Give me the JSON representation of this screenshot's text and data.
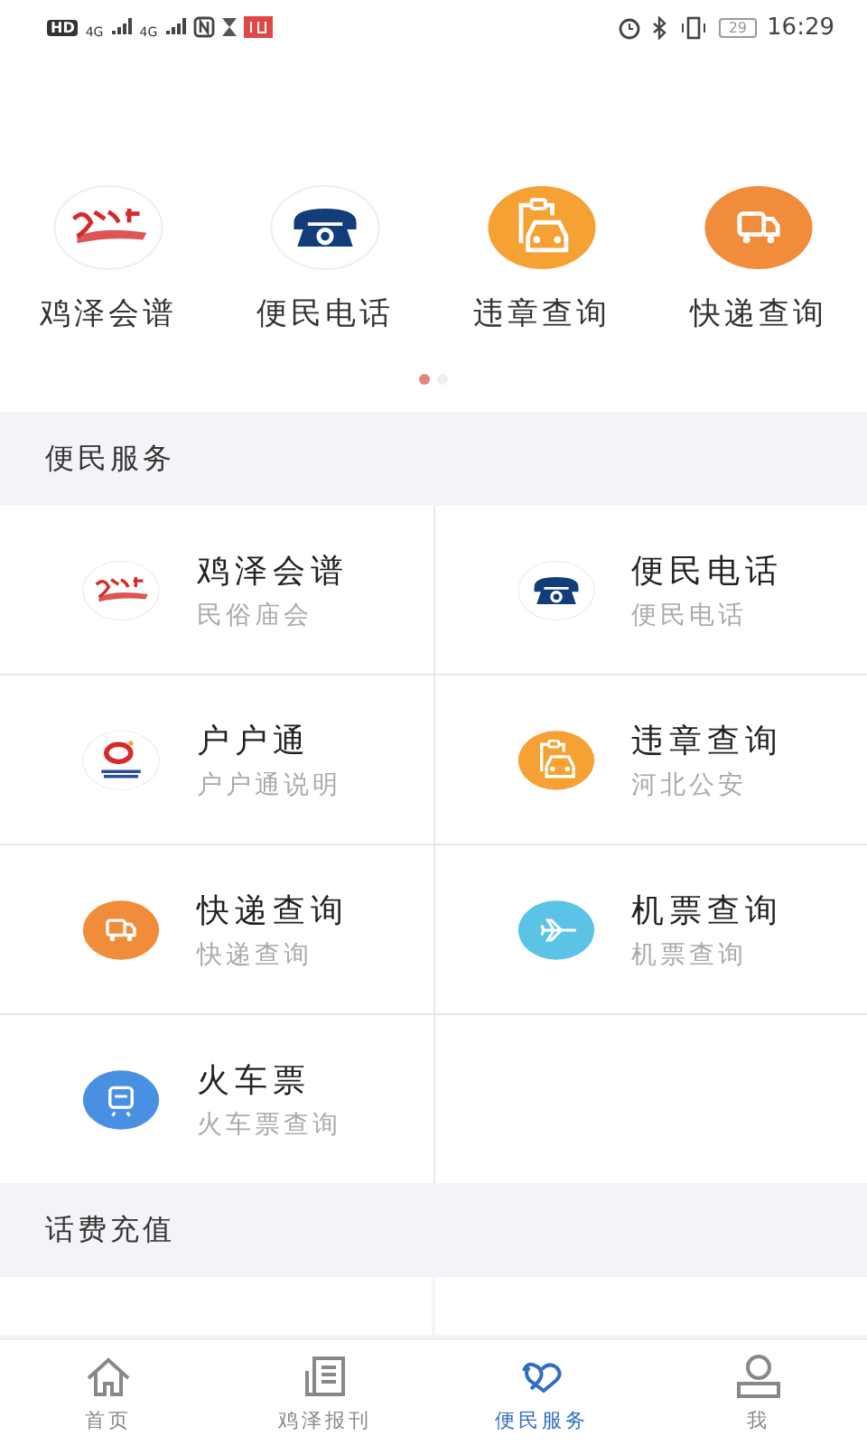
{
  "status_bar": {
    "left": [
      "HD",
      "4G",
      "4G"
    ],
    "battery": "29",
    "time": "16:29"
  },
  "carousel": {
    "items": [
      {
        "label": "鸡泽会谱",
        "kind": "temple"
      },
      {
        "label": "便民电话",
        "kind": "phone"
      },
      {
        "label": "违章查询",
        "kind": "car"
      },
      {
        "label": "快递查询",
        "kind": "truck"
      }
    ],
    "pages": [
      {
        "selected": true
      },
      {
        "selected": false
      }
    ]
  },
  "sections": [
    {
      "title": "便民服务",
      "items": [
        {
          "title": "鸡泽会谱",
          "subtitle": "民俗庙会",
          "kind": "temple"
        },
        {
          "title": "便民电话",
          "subtitle": "便民电话",
          "kind": "phone"
        },
        {
          "title": "户户通",
          "subtitle": "户户通说明",
          "kind": "hht"
        },
        {
          "title": "违章查询",
          "subtitle": "河北公安",
          "kind": "car"
        },
        {
          "title": "快递查询",
          "subtitle": "快递查询",
          "kind": "truck"
        },
        {
          "title": "机票查询",
          "subtitle": "机票查询",
          "kind": "plane"
        },
        {
          "title": "火车票",
          "subtitle": "火车票查询",
          "kind": "train"
        }
      ]
    },
    {
      "title": "话费充值"
    }
  ],
  "nav": [
    {
      "label": "首页",
      "kind": "home",
      "selected": false
    },
    {
      "label": "鸡泽报刊",
      "kind": "news",
      "selected": false
    },
    {
      "label": "便民服务",
      "kind": "hearts",
      "selected": true
    },
    {
      "label": "我",
      "kind": "user",
      "selected": false
    }
  ]
}
